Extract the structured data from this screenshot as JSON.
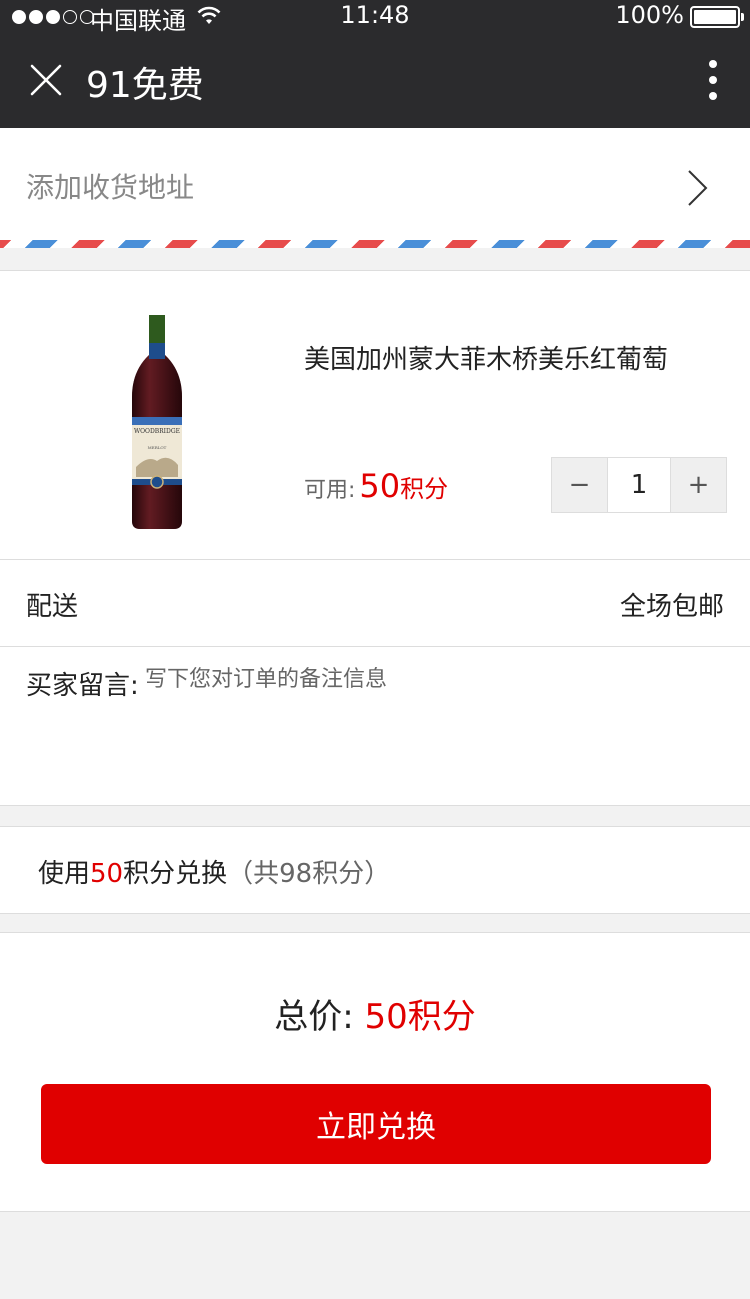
{
  "status_bar": {
    "carrier": "中国联通",
    "time": "11:48",
    "battery": "100%"
  },
  "nav": {
    "title": "91免费"
  },
  "address": {
    "label": "添加收货地址"
  },
  "product": {
    "name": "美国加州蒙大菲木桥美乐红葡萄",
    "points_label": "可用:",
    "points_value": "50",
    "points_unit": "积分",
    "quantity": "1",
    "minus": "−",
    "plus": "+",
    "bottle_label": "WOODBRIDGE",
    "bottle_sublabel": "MERLOT"
  },
  "delivery": {
    "label": "配送",
    "value": "全场包邮"
  },
  "message": {
    "label": "买家留言:",
    "placeholder": "写下您对订单的备注信息"
  },
  "redeem": {
    "prefix": "使用",
    "points": "50",
    "suffix": "积分兑换",
    "total_note": "（共98积分）"
  },
  "footer": {
    "total_label": "总价:",
    "total_value": "50积分",
    "exchange_label": "立即兑换"
  }
}
